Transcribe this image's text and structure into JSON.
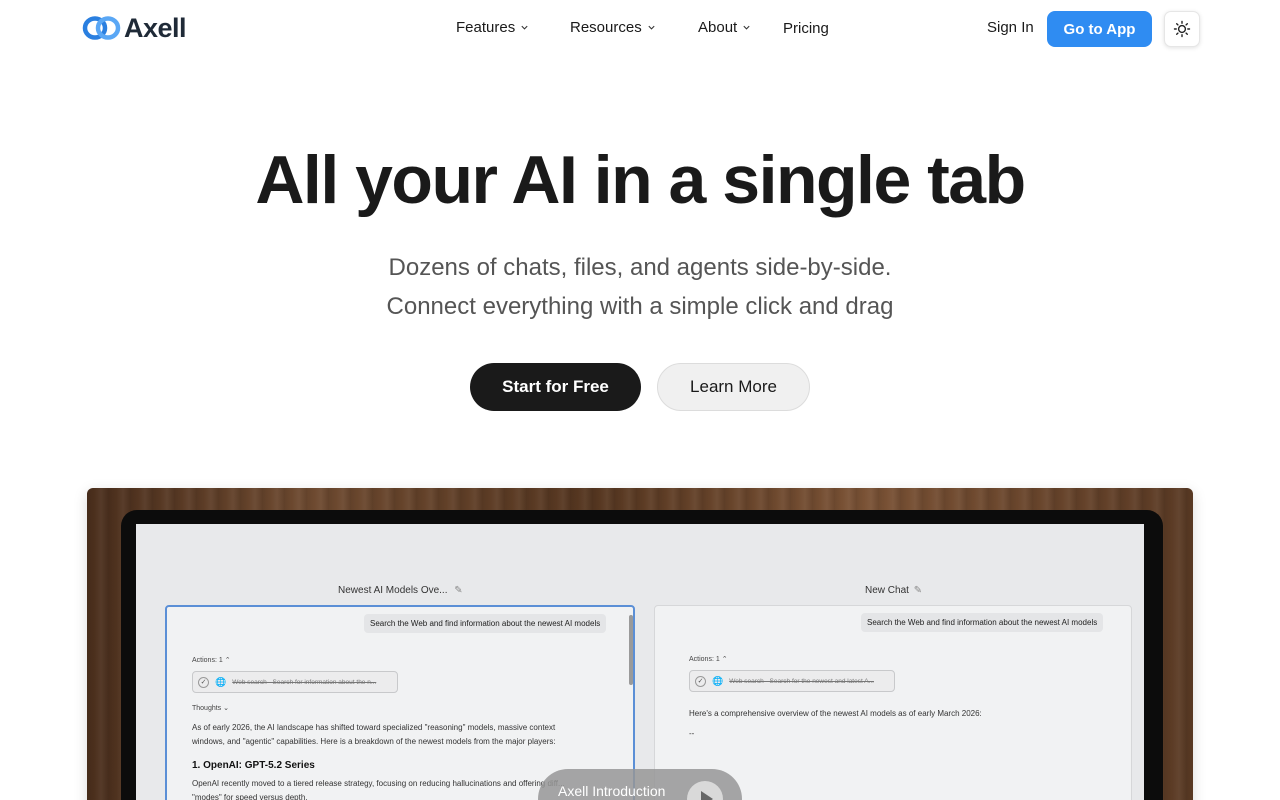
{
  "brand": {
    "name": "Axell",
    "logo_icon": "infinity-rings-icon",
    "accent": "#2f8cf2"
  },
  "nav": {
    "items": [
      {
        "label": "Features",
        "dropdown": true
      },
      {
        "label": "Resources",
        "dropdown": true
      },
      {
        "label": "About",
        "dropdown": true
      },
      {
        "label": "Pricing",
        "dropdown": false
      }
    ],
    "sign_in": "Sign In",
    "go_to_app": "Go to App",
    "theme_icon": "sun-icon"
  },
  "hero": {
    "title": "All your AI in a single tab",
    "subtitle_line1": "Dozens of chats, files, and agents side-by-side.",
    "subtitle_line2": "Connect everything with a simple click and drag",
    "primary_cta": "Start for Free",
    "secondary_cta": "Learn More"
  },
  "showcase": {
    "video_label": "Axell Introduction",
    "left_panel": {
      "title": "Newest AI Models Ove...",
      "prompt": "Search the Web and find information about the newest AI models",
      "actions_label": "Actions: 1",
      "action_text": "Web search - Search for information about the n...",
      "thoughts_label": "Thoughts",
      "body_line1": "As of early 2026, the AI landscape has shifted toward specialized \"reasoning\" models, massive context",
      "body_line2": "windows, and \"agentic\" capabilities. Here is a breakdown of the newest models from the major players:",
      "heading": "1. OpenAI: GPT-5.2 Series",
      "body_line3": "OpenAI recently moved to a tiered release strategy, focusing on reducing hallucinations and offering diff...",
      "body_line4": "\"modes\" for speed versus depth."
    },
    "right_panel": {
      "title": "New Chat",
      "prompt": "Search the Web and find information about the newest AI models",
      "actions_label": "Actions: 1",
      "action_text": "Web search - Search for the newest and latest A...",
      "body_line1": "Here's a comprehensive overview of the newest AI models as of early March 2026:",
      "body_line2": "--"
    }
  }
}
